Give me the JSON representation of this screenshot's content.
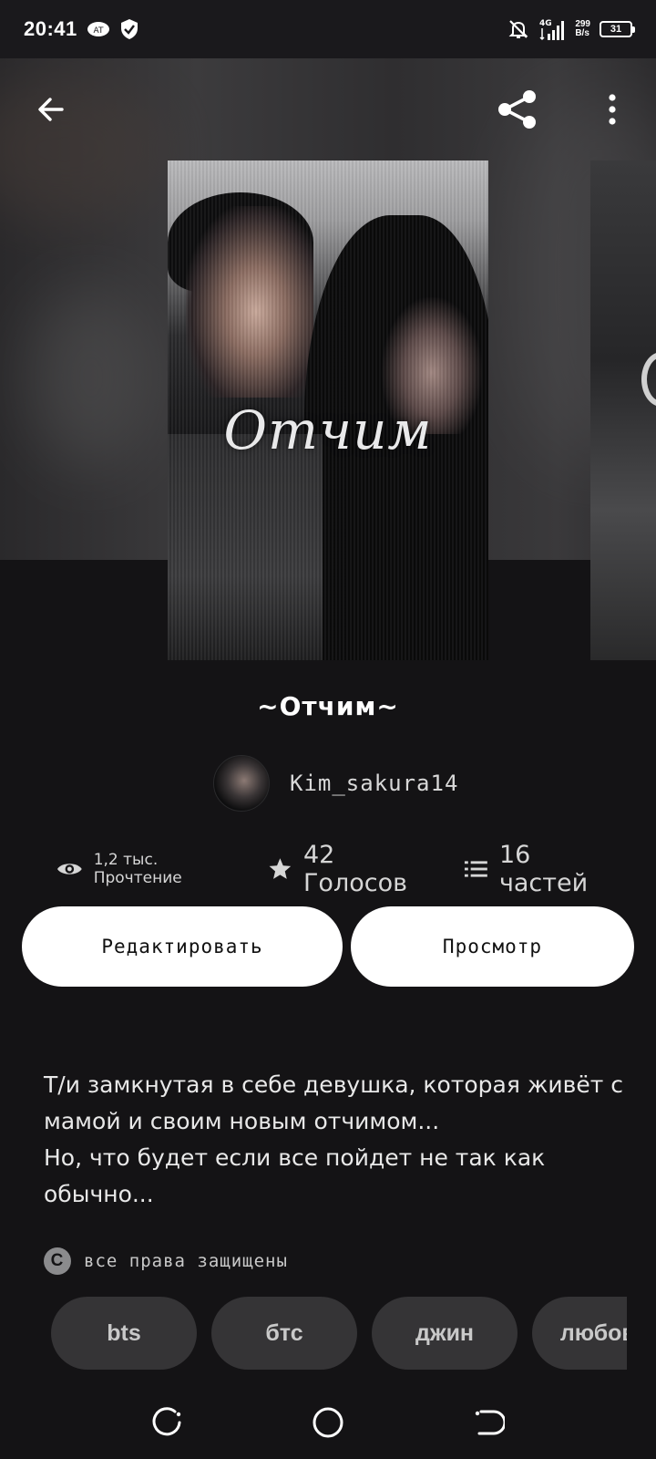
{
  "status_bar": {
    "time": "20:41",
    "netspeed_value": "299",
    "netspeed_unit": "B/s",
    "network": "4G",
    "battery": "31"
  },
  "cover": {
    "title_art": "Отчим"
  },
  "story": {
    "title": "~Отчим~",
    "author": "Kim_sakura14"
  },
  "stats": {
    "reads": "1,2 тыс. Прочтение",
    "votes": "42 Голосов",
    "parts": "16 частей"
  },
  "buttons": {
    "edit": "Редактировать",
    "view": "Просмотр"
  },
  "description": {
    "line1": "Т/и замкнутая в себе девушка, которая живёт с мамой и своим новым отчимом...",
    "line2": "Но, что будет если все пойдет не так как обычно..."
  },
  "rights": {
    "label": "все права защищены"
  },
  "tags": [
    "bts",
    "бтс",
    "джин",
    "любовь"
  ],
  "colors": {
    "background": "#141315",
    "button_bg": "#ffffff",
    "tag_bg": "#353436"
  }
}
